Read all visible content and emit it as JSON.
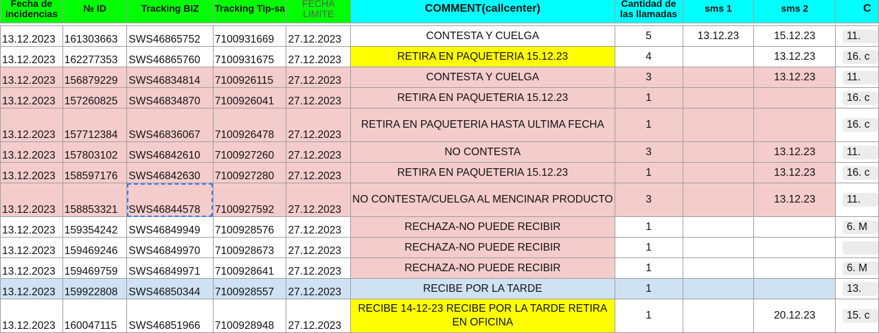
{
  "colors": {
    "header_green": "#00ff00",
    "header_cyan": "#00ffff",
    "row_pink": "#f4cccc",
    "row_white": "#ffffff",
    "row_blue": "#cfe2f3",
    "comment_yellow": "#ffff00",
    "selection_blue": "#3b7be8"
  },
  "headers": [
    "Fecha de incidencias",
    "№ ID",
    "Tracking  BIZ",
    "Tracking Tip-sa",
    "FECHA LIMITE",
    "COMMENT(callcenter)",
    "Cantidad de las llamadas",
    "sms 1",
    "sms 2",
    "C"
  ],
  "rows": [
    {
      "fecha": "13.12.2023",
      "id": "161303663",
      "biz": "SWS46865752",
      "tipsa": "7100931669",
      "limite": "27.12.2023",
      "comment": "CONTESTA Y CUELGA",
      "llamadas": "5",
      "sms1": "13.12.23",
      "sms2": "15.12.23",
      "extra": "11.",
      "bg": "white",
      "comment_bg": "",
      "tall": false
    },
    {
      "fecha": "13.12.2023",
      "id": "162277353",
      "biz": "SWS46865760",
      "tipsa": "7100931675",
      "limite": "27.12.2023",
      "comment": "RETIRA EN PAQUETERIA 15.12.23",
      "llamadas": "4",
      "sms1": "",
      "sms2": "13.12.23",
      "extra": "16. c",
      "bg": "white",
      "comment_bg": "yellow",
      "tall": false
    },
    {
      "fecha": "13.12.2023",
      "id": "156879229",
      "biz": "SWS46834814",
      "tipsa": "7100926115",
      "limite": "27.12.2023",
      "comment": "CONTESTA Y CUELGA",
      "llamadas": "3",
      "sms1": "",
      "sms2": "13.12.23",
      "extra": "11.",
      "bg": "pink",
      "comment_bg": "",
      "tall": false
    },
    {
      "fecha": "13.12.2023",
      "id": "157260825",
      "biz": "SWS46834870",
      "tipsa": "7100926041",
      "limite": "27.12.2023",
      "comment": "RETIRA EN PAQUETERIA 15.12.23",
      "llamadas": "1",
      "sms1": "",
      "sms2": "",
      "extra": "16. c",
      "bg": "pink",
      "comment_bg": "",
      "tall": false
    },
    {
      "fecha": "13.12.2023",
      "id": "157712384",
      "biz": "SWS46836067",
      "tipsa": "7100926478",
      "limite": "27.12.2023",
      "comment": "RETIRA EN PAQUETERIA HASTA ULTIMA FECHA",
      "llamadas": "1",
      "sms1": "",
      "sms2": "",
      "extra": "16. c",
      "bg": "pink",
      "comment_bg": "",
      "tall": true
    },
    {
      "fecha": "13.12.2023",
      "id": "157803102",
      "biz": "SWS46842610",
      "tipsa": "7100927260",
      "limite": "27.12.2023",
      "comment": "NO CONTESTA",
      "llamadas": "3",
      "sms1": "",
      "sms2": "13.12.23",
      "extra": "11.",
      "bg": "pink",
      "comment_bg": "",
      "tall": false
    },
    {
      "fecha": "13.12.2023",
      "id": "158597176",
      "biz": "SWS46842630",
      "tipsa": "7100927280",
      "limite": "27.12.2023",
      "comment": "RETIRA EN PAQUETERIA 15.12.23",
      "llamadas": "1",
      "sms1": "",
      "sms2": "13.12.23",
      "extra": "16. c",
      "bg": "pink",
      "comment_bg": "",
      "tall": false
    },
    {
      "fecha": "13.12.2023",
      "id": "158853321",
      "biz": "SWS46844578",
      "tipsa": "7100927592",
      "limite": "27.12.2023",
      "comment": "NO CONTESTA/CUELGA AL MENCINAR PRODUCTO",
      "llamadas": "3",
      "sms1": "",
      "sms2": "13.12.23",
      "extra": "11.",
      "bg": "pink",
      "comment_bg": "",
      "tall": true,
      "selected": true
    },
    {
      "fecha": "13.12.2023",
      "id": "159354242",
      "biz": "SWS46849949",
      "tipsa": "7100928576",
      "limite": "27.12.2023",
      "comment": "RECHAZA-NO PUEDE RECIBIR",
      "llamadas": "1",
      "sms1": "",
      "sms2": "",
      "extra": "6. M",
      "bg": "white",
      "comment_bg": "pink",
      "tall": false
    },
    {
      "fecha": "13.12.2023",
      "id": "159469246",
      "biz": "SWS46849970",
      "tipsa": "7100928673",
      "limite": "27.12.2023",
      "comment": "RECHAZA-NO PUEDE RECIBIR",
      "llamadas": "1",
      "sms1": "",
      "sms2": "",
      "extra": "",
      "bg": "white",
      "comment_bg": "pink",
      "tall": false
    },
    {
      "fecha": "13.12.2023",
      "id": "159469759",
      "biz": "SWS46849971",
      "tipsa": "7100928641",
      "limite": "27.12.2023",
      "comment": "RECHAZA-NO PUEDE RECIBIR",
      "llamadas": "1",
      "sms1": "",
      "sms2": "",
      "extra": "6. M",
      "bg": "white",
      "comment_bg": "pink",
      "tall": false
    },
    {
      "fecha": "13.12.2023",
      "id": "159922808",
      "biz": "SWS46850344",
      "tipsa": "7100928557",
      "limite": "27.12.2023",
      "comment": "RECIBE POR LA TARDE",
      "llamadas": "1",
      "sms1": "",
      "sms2": "",
      "extra": "13.",
      "bg": "blue",
      "comment_bg": "",
      "tall": false
    },
    {
      "fecha": "13.12.2023",
      "id": "160047115",
      "biz": "SWS46851966",
      "tipsa": "7100928948",
      "limite": "27.12.2023",
      "comment": "RECIBE 14-12-23 RECIBE POR LA TARDE RETIRA EN OFICINA",
      "llamadas": "1",
      "sms1": "",
      "sms2": "20.12.23",
      "extra": "15. c",
      "bg": "white",
      "comment_bg": "yellow",
      "tall": true
    }
  ]
}
